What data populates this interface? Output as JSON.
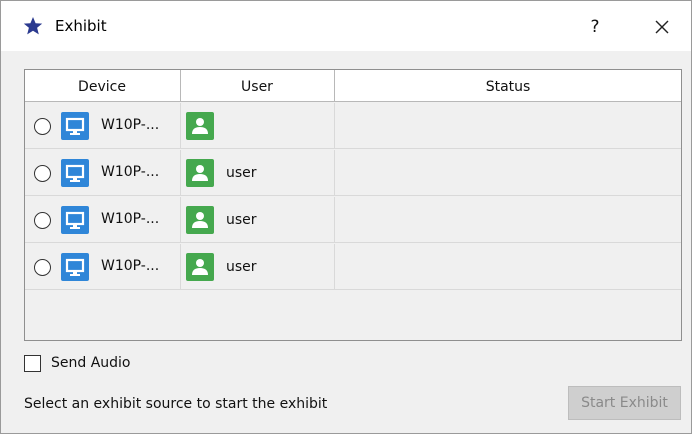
{
  "window": {
    "title": "Exhibit",
    "title_icon": "star-icon",
    "help_label": "?",
    "close_icon": "close-icon"
  },
  "table": {
    "columns": [
      "Device",
      "User",
      "Status"
    ],
    "rows": [
      {
        "device": "W10P-...",
        "user": "",
        "status": "",
        "device_icon": "monitor-icon",
        "user_icon": "person-icon"
      },
      {
        "device": "W10P-...",
        "user": "user",
        "status": "",
        "device_icon": "monitor-icon",
        "user_icon": "person-icon"
      },
      {
        "device": "W10P-...",
        "user": "user",
        "status": "",
        "device_icon": "monitor-icon",
        "user_icon": "person-icon"
      },
      {
        "device": "W10P-...",
        "user": "user",
        "status": "",
        "device_icon": "monitor-icon",
        "user_icon": "person-icon"
      }
    ]
  },
  "options": {
    "send_audio_label": "Send Audio",
    "send_audio_checked": false
  },
  "footer": {
    "message": "Select an exhibit source to start the exhibit",
    "start_label": "Start Exhibit",
    "start_enabled": false
  },
  "colors": {
    "device_icon_bg": "#2f86d8",
    "user_icon_bg": "#45a84e",
    "title_star": "#2b3a8f"
  }
}
